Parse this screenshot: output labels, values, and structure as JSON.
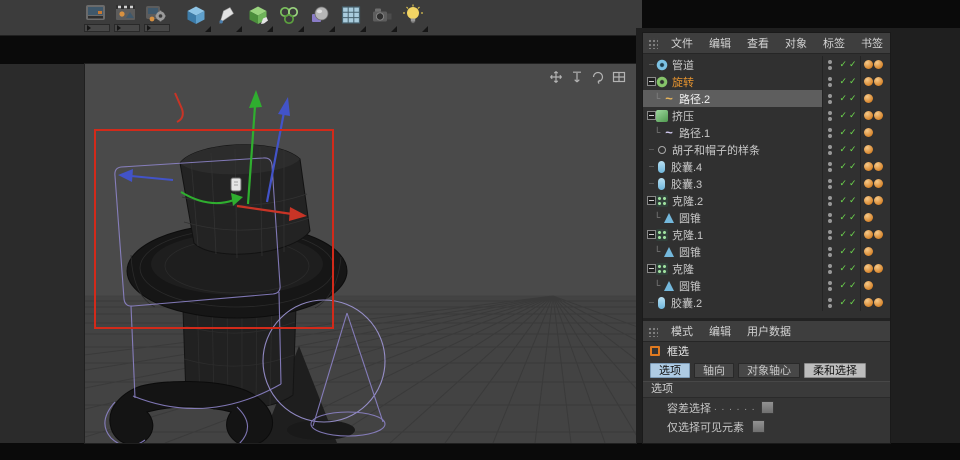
{
  "toolbar": {
    "render_buttons": [
      {
        "name": "render-view"
      },
      {
        "name": "render-to-picture-viewer"
      },
      {
        "name": "render-settings"
      }
    ],
    "tool_buttons": [
      {
        "name": "primitive-cube"
      },
      {
        "name": "spline-pen"
      },
      {
        "name": "generators"
      },
      {
        "name": "modifiers"
      },
      {
        "name": "deformers"
      },
      {
        "name": "floor-environment"
      },
      {
        "name": "camera"
      },
      {
        "name": "light"
      }
    ]
  },
  "viewport": {
    "nav_icons": [
      {
        "name": "pan-view"
      },
      {
        "name": "dolly-view"
      },
      {
        "name": "rotate-view"
      },
      {
        "name": "toggle-view"
      }
    ]
  },
  "object_manager": {
    "menu": [
      {
        "label": "文件"
      },
      {
        "label": "编辑"
      },
      {
        "label": "查看"
      },
      {
        "label": "对象"
      },
      {
        "label": "标签"
      },
      {
        "label": "书签"
      }
    ],
    "rows": [
      {
        "name": "管道",
        "depth": 0,
        "icon": "tube",
        "exp": 0,
        "sel": "",
        "tags": 2
      },
      {
        "name": "旋转",
        "depth": 0,
        "icon": "lathe",
        "exp": 1,
        "sel": "label",
        "tags": 2
      },
      {
        "name": "路径.2",
        "depth": 1,
        "icon": "spline",
        "exp": 0,
        "sel": "row",
        "tags": 1
      },
      {
        "name": "挤压",
        "depth": 0,
        "icon": "extrude",
        "exp": 1,
        "sel": "",
        "tags": 2
      },
      {
        "name": "路径.1",
        "depth": 1,
        "icon": "spline",
        "exp": 0,
        "sel": "",
        "tags": 1
      },
      {
        "name": "胡子和帽子的样条",
        "depth": 0,
        "icon": "nullobj",
        "exp": 0,
        "sel": "",
        "tags": 1
      },
      {
        "name": "胶囊.4",
        "depth": 0,
        "icon": "capsule",
        "exp": 0,
        "sel": "",
        "tags": 2
      },
      {
        "name": "胶囊.3",
        "depth": 0,
        "icon": "capsule",
        "exp": 0,
        "sel": "",
        "tags": 2
      },
      {
        "name": "克隆.2",
        "depth": 0,
        "icon": "cloner",
        "exp": 1,
        "sel": "",
        "tags": 2
      },
      {
        "name": "圆锥",
        "depth": 1,
        "icon": "cone",
        "exp": 0,
        "sel": "",
        "tags": 1
      },
      {
        "name": "克隆.1",
        "depth": 0,
        "icon": "cloner",
        "exp": 1,
        "sel": "",
        "tags": 2
      },
      {
        "name": "圆锥",
        "depth": 1,
        "icon": "cone",
        "exp": 0,
        "sel": "",
        "tags": 1
      },
      {
        "name": "克隆",
        "depth": 0,
        "icon": "cloner",
        "exp": 1,
        "sel": "",
        "tags": 2
      },
      {
        "name": "圆锥",
        "depth": 1,
        "icon": "cone",
        "exp": 0,
        "sel": "",
        "tags": 1
      },
      {
        "name": "胶囊.2",
        "depth": 0,
        "icon": "capsule",
        "exp": 0,
        "sel": "",
        "tags": 2
      }
    ]
  },
  "attribute_manager": {
    "menu": [
      {
        "label": "模式"
      },
      {
        "label": "编辑"
      },
      {
        "label": "用户数据"
      }
    ],
    "tool_label": "框选",
    "tabs": [
      {
        "label": "选项",
        "state": "selected"
      },
      {
        "label": "轴向",
        "state": ""
      },
      {
        "label": "对象轴心",
        "state": ""
      },
      {
        "label": "柔和选择",
        "state": "light"
      }
    ],
    "section_title": "选项",
    "options": [
      {
        "label": "容差选择",
        "leader": ". . . . . .",
        "checked": "false"
      },
      {
        "label": "仅选择可见元素",
        "leader": "",
        "checked": "false"
      }
    ]
  },
  "colors": {
    "selected_label_orange": "#e8952f",
    "check_green": "#6ed84e",
    "tag_orange": "#d8872e",
    "tab_selected_blue": "#aecbe3",
    "gizmo_green": "#2fae2f",
    "gizmo_blue": "#4253c8",
    "gizmo_red": "#c83426",
    "selection_rect_red": "#d22a1a",
    "spline_cage_purple": "#9187cf"
  }
}
